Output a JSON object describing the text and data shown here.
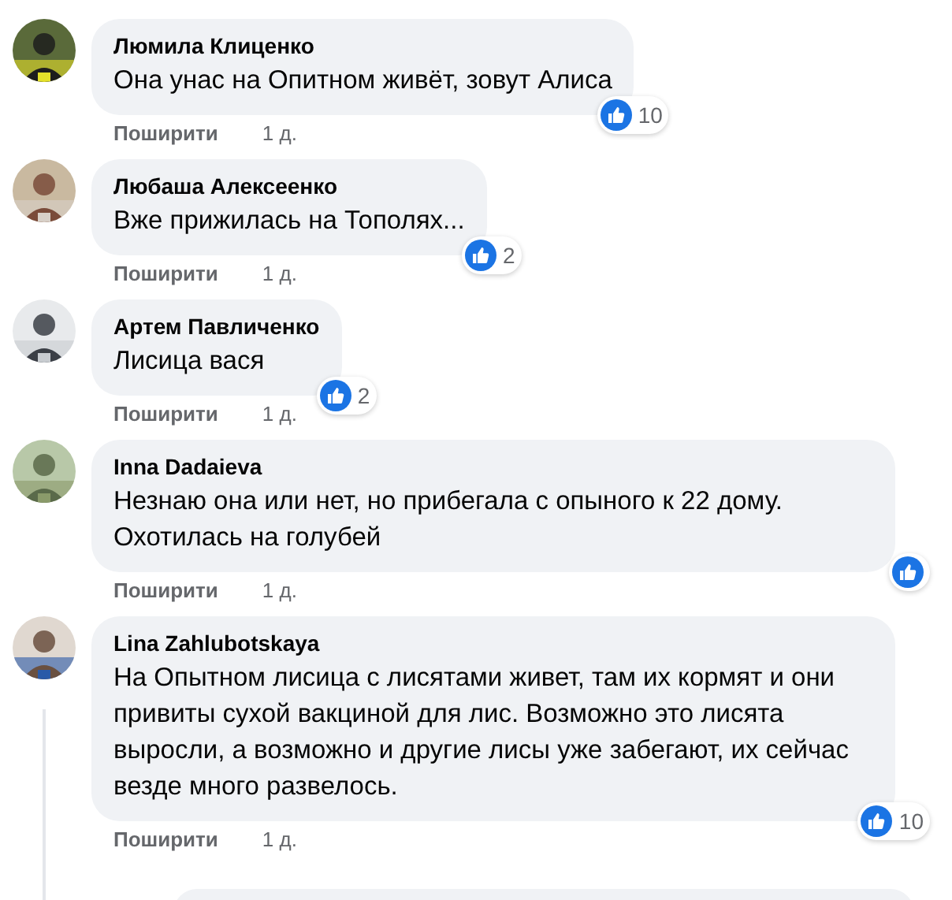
{
  "comments": [
    {
      "author": "Люмила Клиценко",
      "text": "Она унас на Опитном живёт, зовут Алиса",
      "share": "Поширити",
      "time": "1 д.",
      "likes": "10"
    },
    {
      "author": "Любаша Алексеенко",
      "text": "Вже прижилась на Тополях...",
      "share": "Поширити",
      "time": "1 д.",
      "likes": "2"
    },
    {
      "author": "Артем Павличенко",
      "text": "Лисица вася",
      "share": "Поширити",
      "time": "1 д.",
      "likes": "2"
    },
    {
      "author": "Inna Dadaieva",
      "text": "Незнаю она или нет, но прибегала с опыного к 22 дому. Охотилась на голубей",
      "share": "Поширити",
      "time": "1 д."
    },
    {
      "author": "Lina Zahlubotskaya",
      "text": "На Опытном лисица с лисятами живет, там их кормят и они привиты сухой вакциной для лис. Возможно это лисята выросли, а возможно и другие лисы уже забегают, их сейчас везде много развелось.",
      "share": "Поширити",
      "time": "1 д.",
      "likes": "10"
    }
  ]
}
